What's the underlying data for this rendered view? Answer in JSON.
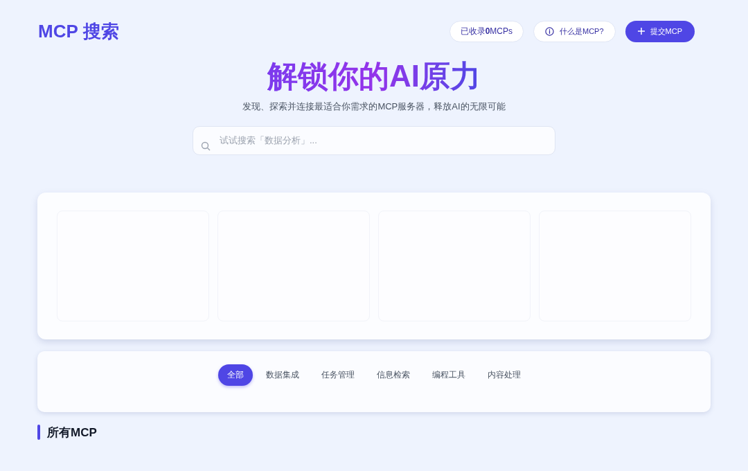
{
  "header": {
    "logo": "MCP 搜索",
    "count_badge": "已收录**0**MCPs",
    "about_button": "什么是MCP?",
    "submit_button": "提交MCP"
  },
  "hero": {
    "title": "解锁你的AI原力",
    "subtitle": "发现、探索并连接最适合你需求的MCP服务器，释放AI的无限可能",
    "search": {
      "placeholder": "试试搜索「数据分析」..."
    }
  },
  "featured": {
    "cards": [
      {
        "kind": "empty"
      },
      {
        "kind": "empty"
      },
      {
        "kind": "empty"
      },
      {
        "kind": "empty"
      }
    ]
  },
  "categories": [
    {
      "label": "全部",
      "selected": true
    },
    {
      "label": "数据集成",
      "selected": false
    },
    {
      "label": "任务管理",
      "selected": false
    },
    {
      "label": "信息检索",
      "selected": false
    },
    {
      "label": "编程工具",
      "selected": false
    },
    {
      "label": "内容处理",
      "selected": false
    }
  ],
  "section_title": "所有MCP"
}
